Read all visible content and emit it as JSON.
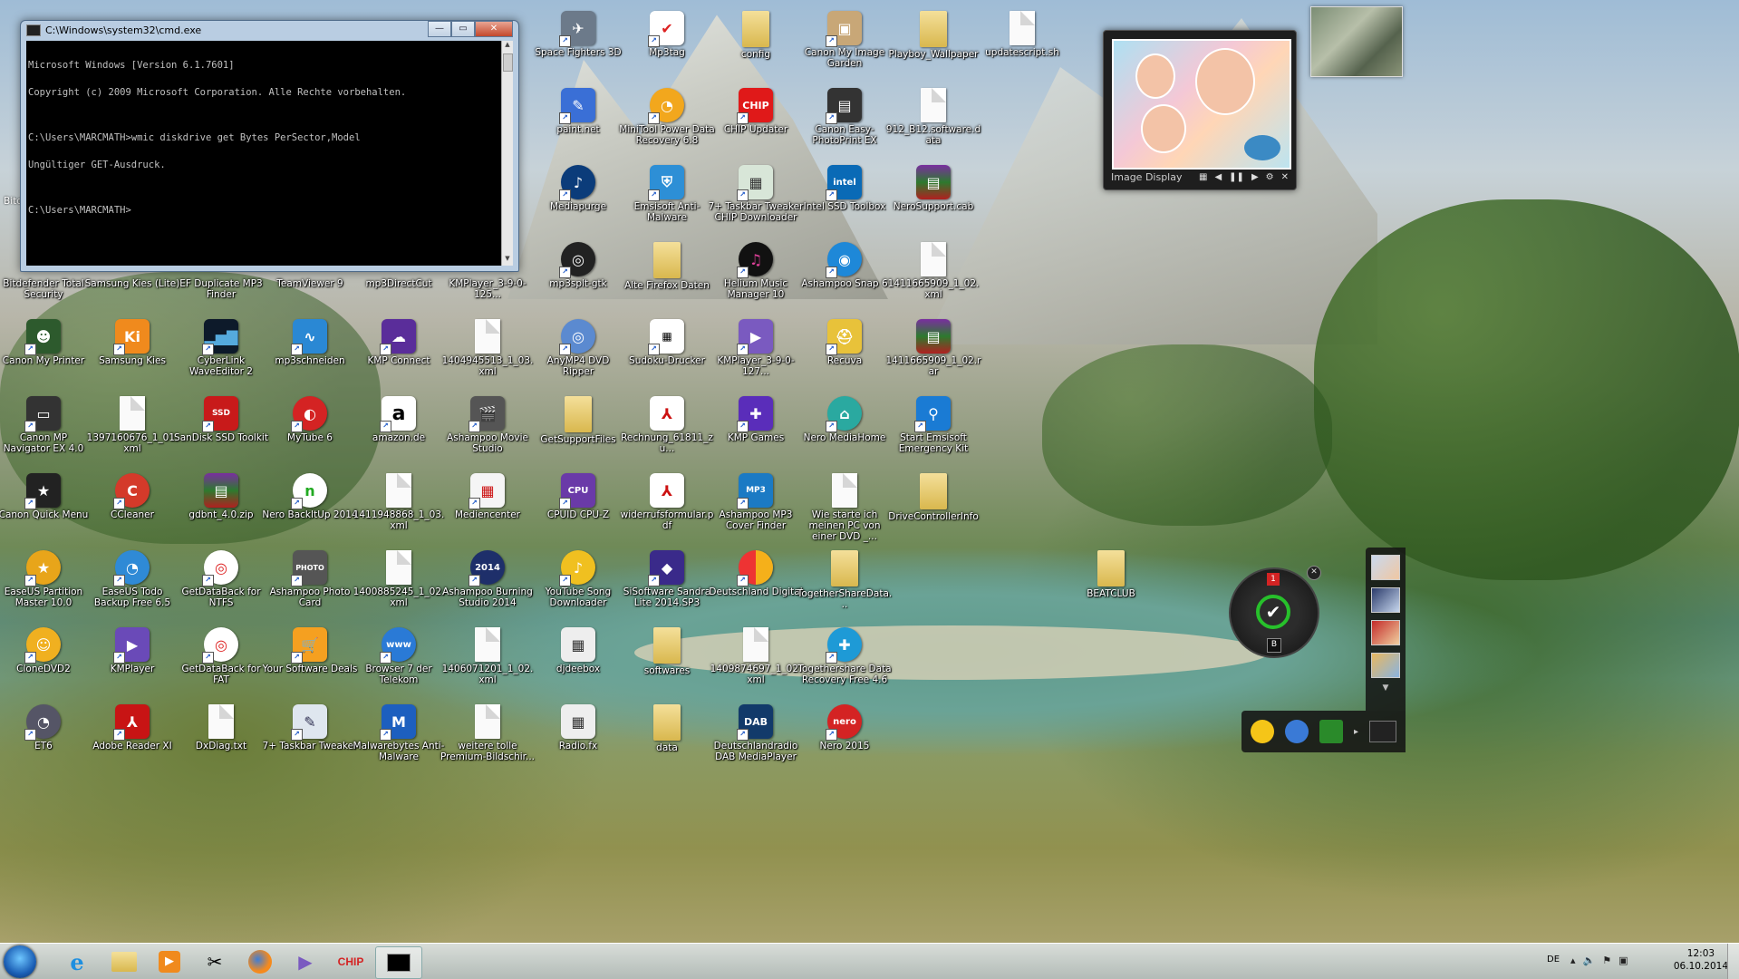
{
  "cmd": {
    "title": "C:\\Windows\\system32\\cmd.exe",
    "lines": [
      "Microsoft Windows [Version 6.1.7601]",
      "Copyright (c) 2009 Microsoft Corporation. Alle Rechte vorbehalten.",
      "",
      "C:\\Users\\MARCMATH>wmic diskdrive get Bytes PerSector,Model",
      "Ungültiger GET-Ausdruck.",
      "",
      "C:\\Users\\MARCMATH>"
    ],
    "buttons": {
      "minimize": "—",
      "maximize": "▭",
      "close": "✕"
    }
  },
  "image_display": {
    "label": "Image Display"
  },
  "dial": {
    "badge": "1",
    "bottom": "B"
  },
  "icons": {
    "space_fighters": "Space Fighters 3D",
    "mp3tag": "Mp3tag",
    "config": "config",
    "canon_image_garden": "Canon My Image Garden",
    "playboy": "Playboy_Wallpaper",
    "updatescript": "updatescript.sh",
    "paint_net": "paint.net",
    "minitool": "MiniTool Power Data Recovery 6.8",
    "chip_updater": "CHIP Updater",
    "canon_easy": "Canon Easy-PhotoPrint EX",
    "data_912": "912_B12.software.data",
    "mediapurge": "Mediapurge",
    "emsisoft": "Emsisoft Anti-Malware",
    "tweaker_chip": "7+ Taskbar Tweaker CHIP Downloader",
    "intel_ssd": "Intel SSD Toolbox",
    "nerosupport": "NeroSupport.cab",
    "bitdefender": "Bitdefender Total Security",
    "samsung_kies_lite": "Samsung Kies (Lite)",
    "ef_duplicate": "EF Duplicate MP3 Finder",
    "teamviewer": "TeamViewer 9",
    "mp3directcut": "mp3DirectCut",
    "kmplayer_a": "KMPlayer_3-9-0-125...",
    "mp3splt": "mp3splt-gtk",
    "alte_firefox": "Alte Firefox Daten",
    "helium": "Helium Music Manager 10",
    "ashampoo_snap": "Ashampoo Snap 6",
    "xml_1411": "1411665909_1_02.xml",
    "canon_printer": "Canon My Printer",
    "samsung_kies": "Samsung Kies",
    "wave_editor": "CyberLink WaveEditor 2",
    "mp3schneiden": "mp3schneiden",
    "kmp_connect": "KMP Connect",
    "xml_1404": "1404945513_1_03.xml",
    "anymp4": "AnyMP4 DVD Ripper",
    "sudoku": "Sudoku-Drucker",
    "kmplayer_b": "KMPlayer_3-9-0-127...",
    "recuva": "Recuva",
    "rar_1411": "1411665909_1_02.rar",
    "canon_mp": "Canon MP Navigator EX 4.0",
    "xml_1397": "1397160676_1_01.xml",
    "sandisk": "SanDisk SSD Toolkit",
    "mytube": "MyTube 6",
    "amazon": "amazon.de",
    "ashampoo_movie": "Ashampoo Movie Studio",
    "getsupport": "GetSupportFiles",
    "rechnung": "Rechnung_61811_zu...",
    "kmp_games": "KMP Games",
    "nero_mediahome": "Nero MediaHome",
    "start_emsisoft": "Start Emsisoft Emergency Kit",
    "canon_quick": "Canon Quick Menu",
    "ccleaner": "CCleaner",
    "gdbnt": "gdbnt_4.0.zip",
    "nero_backitup": "Nero BackItUp 2014",
    "xml_1411948": "1411948868_1_03.xml",
    "mediencenter": "Mediencenter",
    "cpuz": "CPUID CPU-Z",
    "widerruf": "widerrufsformular.pdf",
    "ashampoo_mp3": "Ashampoo MP3 Cover Finder",
    "wie_starte": "Wie starte ich meinen PC von einer DVD _...",
    "drivecontroller": "DriveControllerInfo",
    "easeus_part": "EaseUS Partition Master 10.0",
    "easeus_todo": "EaseUS Todo Backup Free 6.5",
    "getdata_ntfs": "GetDataBack for NTFS",
    "ashampoo_photo": "Ashampoo Photo Card",
    "xml_1400": "1400885245_1_02.xml",
    "ashampoo_burn": "Ashampoo Burning Studio 2014",
    "youtube_song": "YouTube Song Downloader",
    "sisoftware": "SiSoftware Sandra Lite 2014.SP3",
    "deutschland": "Deutschland Digital",
    "together_data": "TogetherShareData...",
    "beatclub": "BEATCLUB",
    "clonedvd": "CloneDVD2",
    "kmplayer": "KMPlayer",
    "getdata_fat": "GetDataBack for FAT",
    "software_deals": "Your Software Deals",
    "browser7": "Browser 7 der Telekom",
    "xml_1406": "1406071201_1_02.xml",
    "djdeebox": "djdeebox",
    "softwares": "softwares",
    "xml_1409": "1409874697_1_02.xml",
    "together_free": "Togethershare Data Recovery Free 4.6",
    "et6": "ET6",
    "adobe": "Adobe Reader XI",
    "dxdiag": "DxDiag.txt",
    "taskbar_tweaker": "7+ Taskbar Tweaker",
    "malwarebytes": "Malwarebytes Anti-Malware",
    "weitere": "weitere tolle Premium-Bildschir...",
    "radiofx": "Radio.fx",
    "data": "data",
    "dab": "Deutschlandradio DAB MediaPlayer",
    "nero2015": "Nero 2015",
    "bitd_partial": "Bitd"
  },
  "taskbar": {
    "chip": "CHIP",
    "lang": "DE",
    "time": "12:03",
    "date": "06.10.2014"
  }
}
